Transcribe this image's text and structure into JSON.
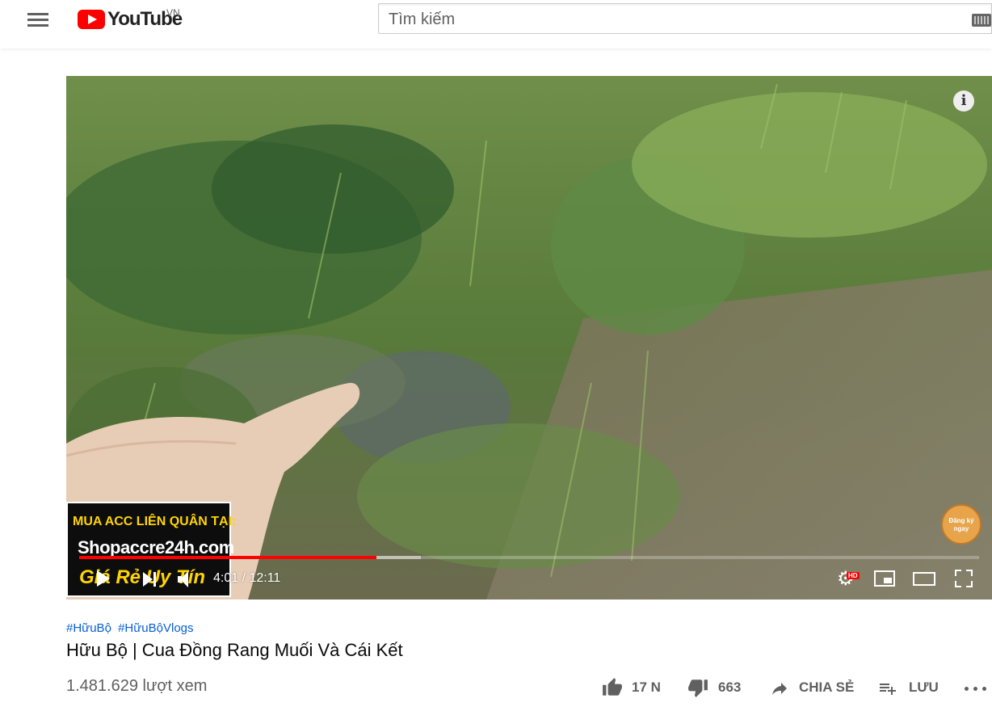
{
  "header": {
    "logo_text": "YouTube",
    "country_code": "VN",
    "search_placeholder": "Tìm kiếm"
  },
  "player": {
    "ad_banner": {
      "line1": "MUA ACC LIÊN QUÂN TẠI:",
      "line2": "Shopaccre24h.com",
      "line3": "Giá Rẻ Uy Tín"
    },
    "subscribe_watermark": "Đăng ký ngay",
    "current_time": "4:01",
    "duration": "12:11",
    "time_display": "4:01 / 12:11",
    "progress_fraction": 0.33,
    "buffer_fraction": 0.38,
    "quality_badge": "HD",
    "progress_color": "#ff0000"
  },
  "video": {
    "hashtags": [
      "#HữuBộ",
      "#HữuBộVlogs"
    ],
    "title": "Hữu Bộ | Cua Đồng Rang Muối Và Cái Kết",
    "views": "1.481.629 lượt xem"
  },
  "actions": {
    "like_count": "17 N",
    "dislike_count": "663",
    "share_label": "CHIA SẺ",
    "save_label": "LƯU"
  }
}
